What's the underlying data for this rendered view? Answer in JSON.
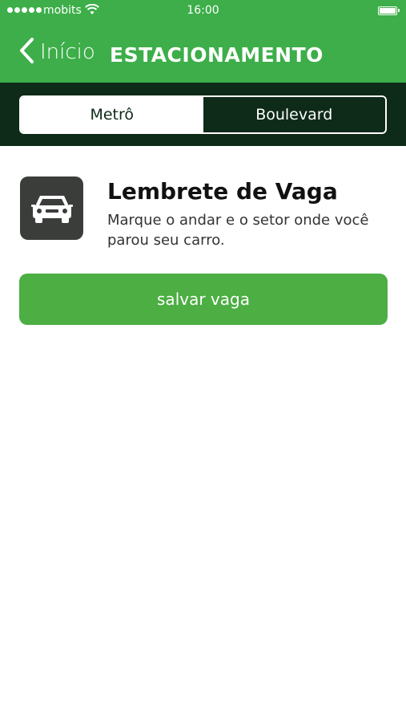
{
  "status_bar": {
    "carrier": "mobits",
    "time": "16:00",
    "signal_icon": "signal-dots-icon",
    "wifi_icon": "wifi-icon",
    "battery_icon": "battery-icon",
    "battery_level": 1.0
  },
  "nav": {
    "back_label": "Início",
    "back_icon": "chevron-left-icon",
    "title": "ESTACIONAMENTO"
  },
  "segments": {
    "items": [
      {
        "label": "Metrô",
        "selected": true
      },
      {
        "label": "Boulevard",
        "selected": false
      }
    ]
  },
  "reminder": {
    "icon": "car-icon",
    "title": "Lembrete de Vaga",
    "description": "Marque o andar e o setor onde você parou seu carro."
  },
  "actions": {
    "save_label": "salvar vaga"
  },
  "colors": {
    "brand_green": "#3dae49",
    "button_green": "#4cae43",
    "dark_green": "#0e2a18",
    "icon_box": "#3b3d3b"
  }
}
